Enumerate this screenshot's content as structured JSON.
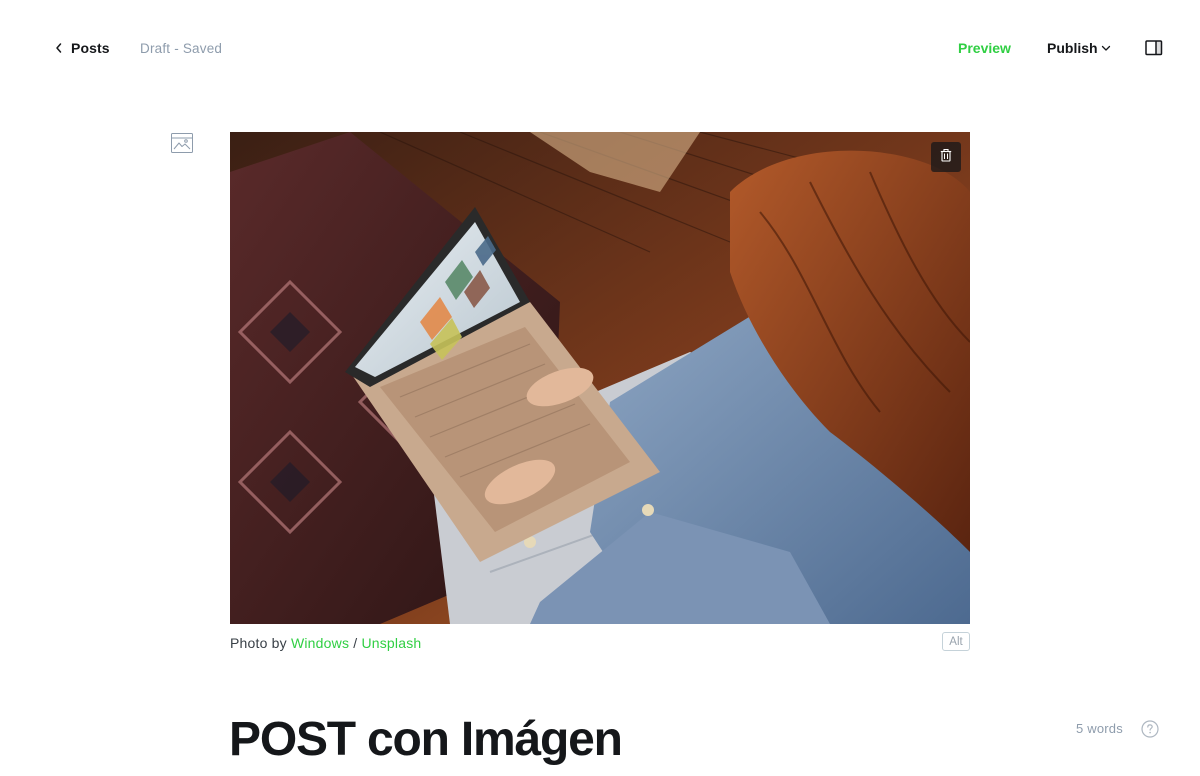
{
  "header": {
    "back_label": "Posts",
    "status": "Draft - Saved",
    "preview_label": "Preview",
    "publish_label": "Publish",
    "accent_color": "#30cf43",
    "icons": {
      "back": "chevron-left-icon",
      "publish_caret": "chevron-down-icon",
      "sidebar_toggle": "sidebar-panel-icon"
    }
  },
  "editor": {
    "image_card_icon": "image-icon",
    "delete_icon": "trash-icon",
    "caption": {
      "prefix": "Photo by ",
      "author": "Windows",
      "separator": " / ",
      "source": "Unsplash"
    },
    "alt_label": "Alt",
    "title": "POST con Imágen",
    "word_count": "5 words",
    "help_icon": "question-circle-icon"
  }
}
